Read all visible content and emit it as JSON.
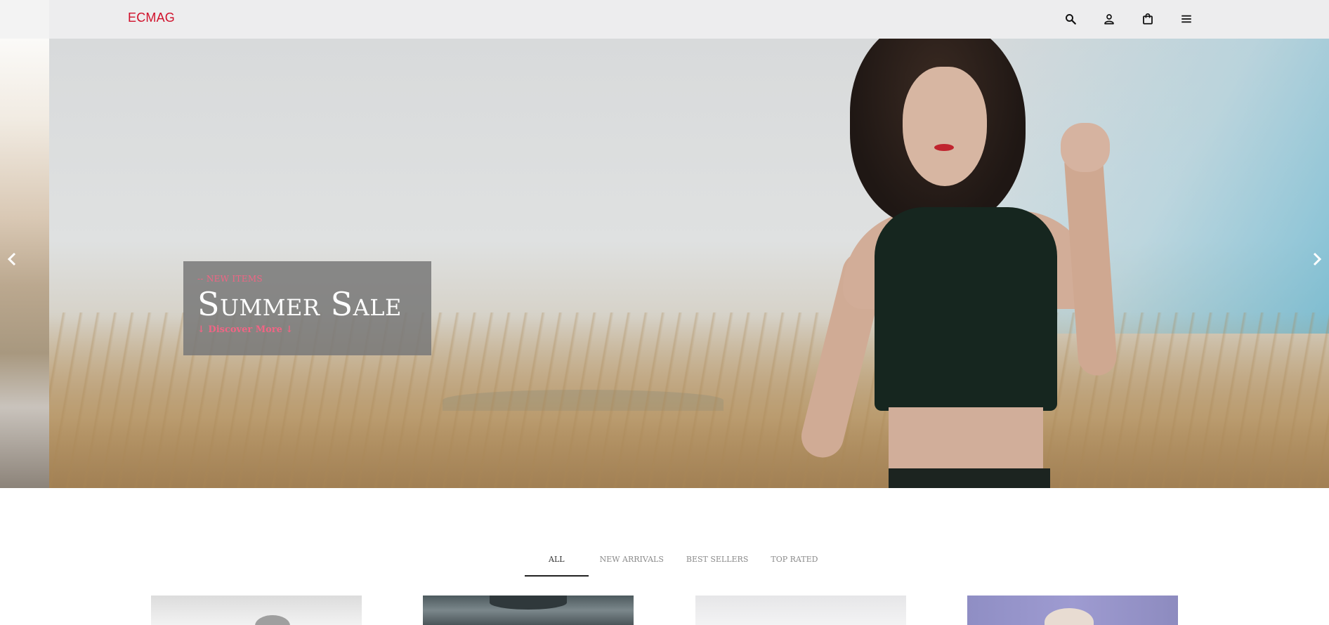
{
  "brand": {
    "logo": "ECMAG",
    "accent": "#d0112b"
  },
  "header": {
    "icons": [
      {
        "name": "search-icon"
      },
      {
        "name": "user-icon"
      },
      {
        "name": "shopping-bag-icon"
      },
      {
        "name": "menu-icon"
      }
    ]
  },
  "hero": {
    "eyebrow": "-- NEW ITEMS",
    "title": "Summer Sale",
    "cta": "↓ Discover More ↓",
    "accent": "#f06584"
  },
  "tabs": [
    {
      "label": "ALL",
      "active": true
    },
    {
      "label": "NEW ARRIVALS",
      "active": false
    },
    {
      "label": "BEST SELLERS",
      "active": false
    },
    {
      "label": "TOP RATED",
      "active": false
    }
  ]
}
